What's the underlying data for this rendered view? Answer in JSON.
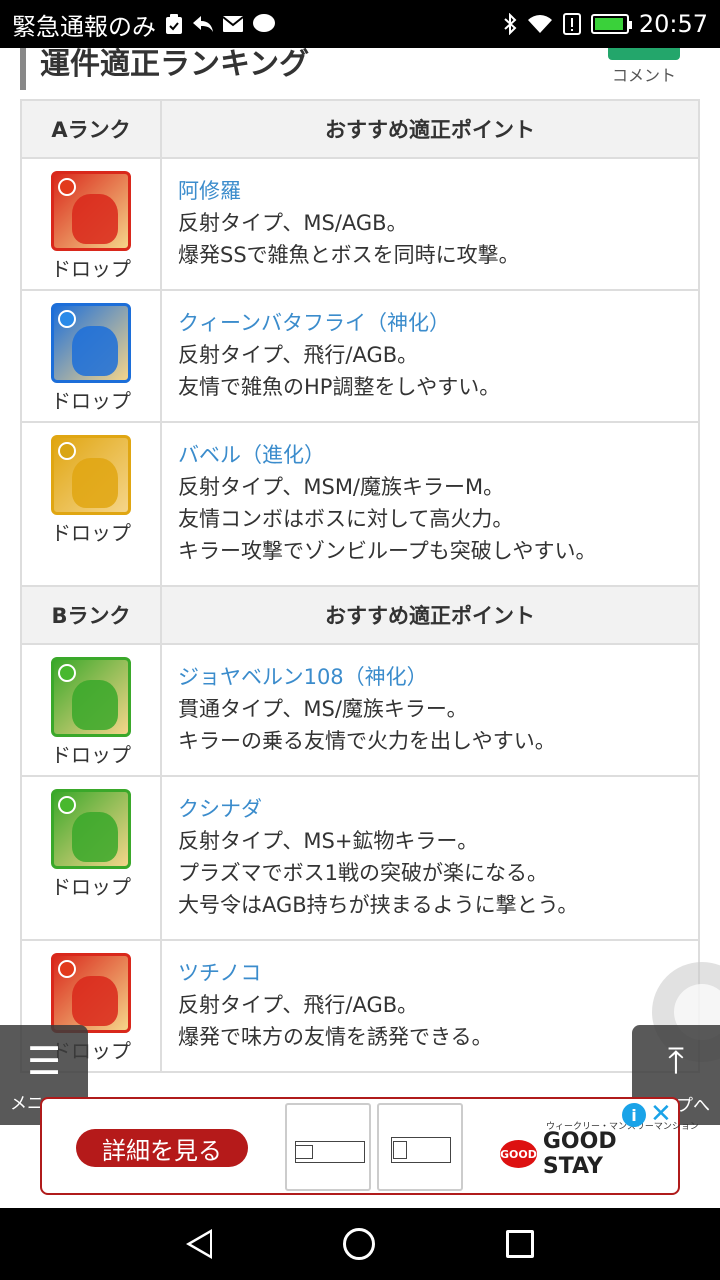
{
  "status_bar": {
    "notification_text": "緊急通報のみ",
    "time": "20:57",
    "icons": [
      "clipboard-icon",
      "reply-icon",
      "mail-icon",
      "line-icon",
      "bluetooth-icon",
      "wifi-icon",
      "alert-icon",
      "battery-icon"
    ]
  },
  "section": {
    "title": "運件適正ランキング",
    "comment_label": "コメント"
  },
  "tables": [
    {
      "rank_header": "Aランク",
      "point_header": "おすすめ適正ポイント",
      "rows": [
        {
          "name": "阿修羅",
          "lines": [
            "反射タイプ、MS/AGB。",
            "爆発SSで雑魚とボスを同時に攻撃。"
          ],
          "drop": "ドロップ",
          "frame_color": "#d9281b",
          "orb_color": "#e23a1c"
        },
        {
          "name": "クィーンバタフライ（神化）",
          "lines": [
            "反射タイプ、飛行/AGB。",
            "友情で雑魚のHP調整をしやすい。"
          ],
          "drop": "ドロップ",
          "frame_color": "#1c6ed9",
          "orb_color": "#2a8ae8"
        },
        {
          "name": "バベル（進化）",
          "lines": [
            "反射タイプ、MSM/魔族キラーM。",
            "友情コンボはボスに対して高火力。",
            "キラー攻撃でゾンビループも突破しやすい。"
          ],
          "drop": "ドロップ",
          "frame_color": "#e0a612",
          "orb_color": "#d9a514"
        }
      ]
    },
    {
      "rank_header": "Bランク",
      "point_header": "おすすめ適正ポイント",
      "rows": [
        {
          "name": "ジョヤベルン108（神化）",
          "lines": [
            "貫通タイプ、MS/魔族キラー。",
            "キラーの乗る友情で火力を出しやすい。"
          ],
          "drop": "ドロップ",
          "frame_color": "#3aa82a",
          "orb_color": "#48b82e"
        },
        {
          "name": "クシナダ",
          "lines": [
            "反射タイプ、MS+鉱物キラー。",
            "プラズマでボス1戦の突破が楽になる。",
            "大号令はAGB持ちが挟まるように撃とう。"
          ],
          "drop": "ドロップ",
          "frame_color": "#3aa82a",
          "orb_color": "#48b82e"
        },
        {
          "name": "ツチノコ",
          "lines": [
            "反射タイプ、飛行/AGB。",
            "爆発で味方の友情を誘発できる。"
          ],
          "drop": "ドロップ",
          "frame_color": "#d9281b",
          "orb_color": "#e23a1c"
        }
      ]
    }
  ],
  "floating": {
    "menu_label": "メニュー",
    "top_label": "トップへ"
  },
  "ad": {
    "cta_label": "詳細を見る",
    "brand_logo": "GOOD",
    "brand_name": "GOOD STAY",
    "brand_tag": "ウィークリー・マンスリーマンション",
    "info_label": "i",
    "close_label": "✕"
  }
}
